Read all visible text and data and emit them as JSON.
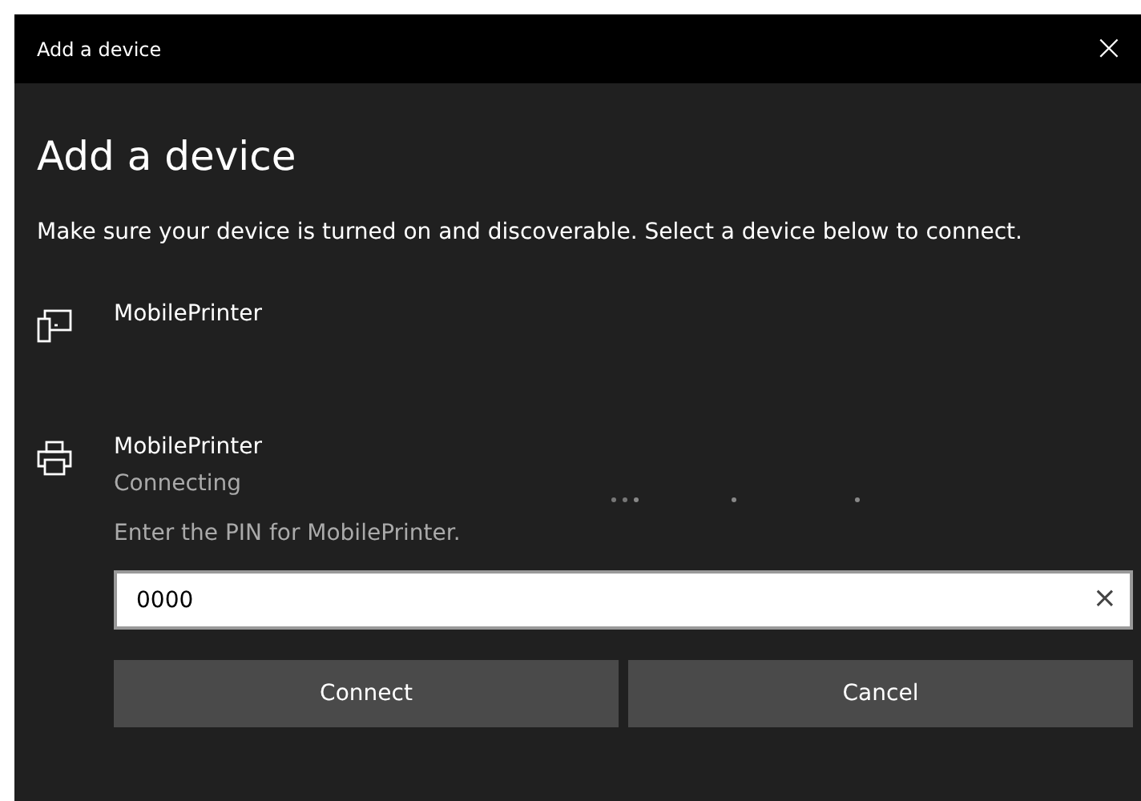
{
  "window": {
    "title": "Add a device",
    "close": "×"
  },
  "heading": "Add a device",
  "description": "Make sure your device is turned on and discoverable. Select a device below to connect.",
  "devices": [
    {
      "kind": "tablet",
      "name": "MobilePrinter"
    },
    {
      "kind": "printer",
      "name": "MobilePrinter",
      "status": "Connecting",
      "pin_prompt": "Enter the PIN for MobilePrinter.",
      "pin": {
        "value": "0000",
        "clear": "×"
      },
      "buttons": [
        "Connect",
        "Cancel"
      ]
    }
  ]
}
